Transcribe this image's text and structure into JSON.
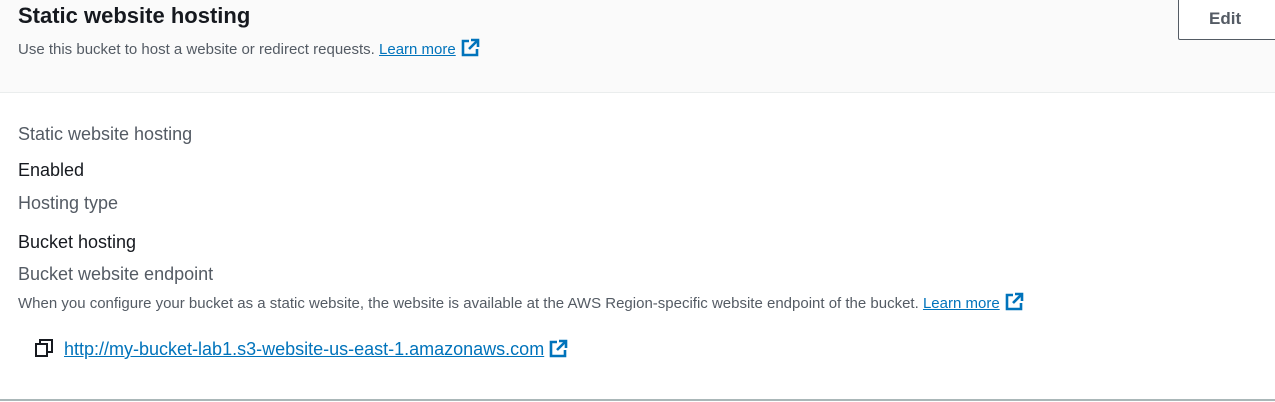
{
  "header": {
    "title": "Static website hosting",
    "subtitle": "Use this bucket to host a website or redirect requests.",
    "learn_more": "Learn more",
    "edit_label": "Edit"
  },
  "details": {
    "hosting_label": "Static website hosting",
    "hosting_value": "Enabled",
    "type_label": "Hosting type",
    "type_value": "Bucket hosting",
    "endpoint_label": "Bucket website endpoint",
    "endpoint_description": "When you configure your bucket as a static website, the website is available at the AWS Region-specific website endpoint of the bucket.",
    "endpoint_learn_more": "Learn more",
    "endpoint_url": "http://my-bucket-lab1.s3-website-us-east-1.amazonaws.com"
  },
  "icons": {
    "external_link": "external-link-icon",
    "copy": "copy-icon"
  },
  "colors": {
    "link": "#0073bb",
    "text": "#16191f",
    "secondary_text": "#545b64",
    "header_bg": "#fafafa"
  }
}
